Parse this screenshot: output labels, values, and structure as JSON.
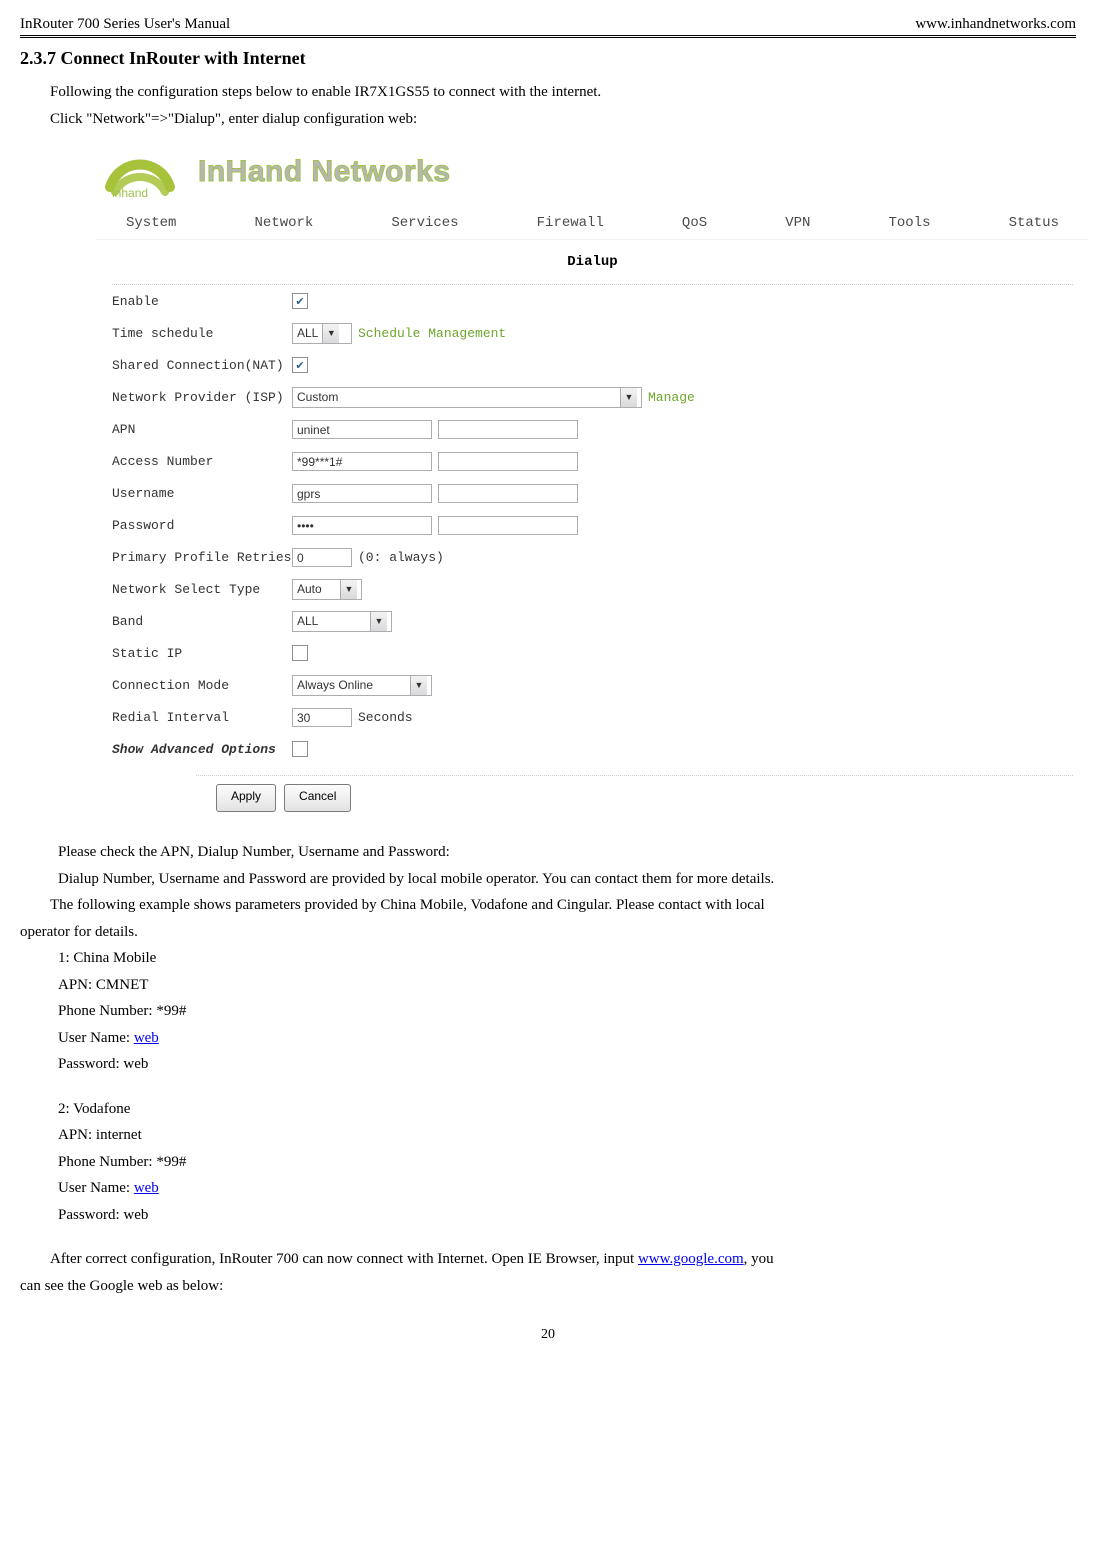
{
  "header": {
    "left": "InRouter 700 Series User's Manual",
    "right": "www.inhandnetworks.com"
  },
  "section_heading": "2.3.7 Connect InRouter with Internet",
  "para1": "Following the configuration steps below to enable IR7X1GS55 to connect with the internet.",
  "para2": "Click \"Network\"=>\"Dialup\", enter dialup configuration web:",
  "figure": {
    "logo_text": "InHand Networks",
    "menu": [
      "System",
      "Network",
      "Services",
      "Firewall",
      "QoS",
      "VPN",
      "Tools",
      "Status"
    ],
    "panel_title": "Dialup",
    "rows": {
      "enable": "Enable",
      "time_schedule": "Time schedule",
      "time_schedule_value": "ALL",
      "schedule_mgmt": "Schedule Management",
      "shared_nat": "Shared Connection(NAT)",
      "isp": "Network Provider (ISP)",
      "isp_value": "Custom",
      "manage": "Manage",
      "apn": "APN",
      "apn_value": "uninet",
      "access_number": "Access Number",
      "access_number_value": "*99***1#",
      "username": "Username",
      "username_value": "gprs",
      "password": "Password",
      "password_value": "••••",
      "primary_retries": "Primary Profile Retries",
      "primary_retries_value": "0",
      "primary_retries_note": "(0: always)",
      "network_select": "Network Select Type",
      "network_select_value": "Auto",
      "band": "Band",
      "band_value": "ALL",
      "static_ip": "Static IP",
      "conn_mode": "Connection Mode",
      "conn_mode_value": "Always Online",
      "redial": "Redial Interval",
      "redial_value": "30",
      "redial_unit": "Seconds",
      "show_adv": "Show Advanced Options"
    },
    "buttons": {
      "apply": "Apply",
      "cancel": "Cancel"
    }
  },
  "after": {
    "p_check": "Please check the APN, Dialup Number, Username and Password:",
    "p_provided": "Dialup Number, Username and Password are provided by local mobile operator. You can contact them for more details.",
    "p_example_a": "The following example shows parameters provided by China Mobile, Vodafone and Cingular. Please contact with local",
    "p_example_b": "operator for details.",
    "ex1_title": "1: China Mobile",
    "ex1_apn": "APN: CMNET",
    "ex1_phone": "Phone Number: *99#",
    "ex1_user_label": "User Name: ",
    "ex1_user_link": "web",
    "ex1_pass": "Password: web",
    "ex2_title": "2: Vodafone",
    "ex2_apn": "APN: internet",
    "ex2_phone": "Phone Number: *99#",
    "ex2_user_label": "User Name: ",
    "ex2_user_link": "web",
    "ex2_pass": "Password: web",
    "final_a": "After correct configuration, InRouter 700 can now connect with Internet. Open IE Browser, input ",
    "final_link": "www.google.com",
    "final_b": ", you",
    "final_c": "can see the Google web as below:"
  },
  "page_number": "20"
}
